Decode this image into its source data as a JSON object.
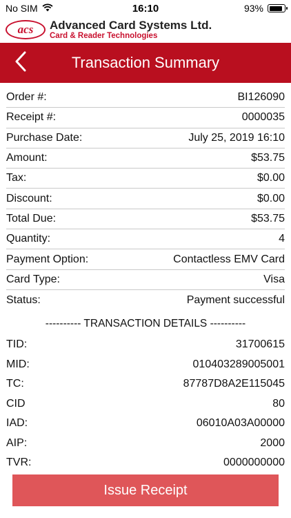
{
  "status_bar": {
    "carrier": "No SIM",
    "time": "16:10",
    "battery_percent": "93%",
    "battery_level": 0.93,
    "wifi_icon": "wifi-icon",
    "battery_icon": "battery-icon"
  },
  "brand": {
    "logo_text": "acs",
    "name": "Advanced Card Systems Ltd.",
    "tagline": "Card & Reader Technologies"
  },
  "nav": {
    "back_icon": "chevron-left-icon",
    "title": "Transaction Summary"
  },
  "summary": [
    {
      "label": "Order #:",
      "value": "BI126090"
    },
    {
      "label": "Receipt #:",
      "value": "0000035"
    },
    {
      "label": "Purchase Date:",
      "value": "July 25, 2019 16:10"
    },
    {
      "label": "Amount:",
      "value": "$53.75"
    },
    {
      "label": "Tax:",
      "value": "$0.00"
    },
    {
      "label": "Discount:",
      "value": "$0.00"
    },
    {
      "label": "Total Due:",
      "value": "$53.75"
    },
    {
      "label": "Quantity:",
      "value": "4"
    },
    {
      "label": "Payment Option:",
      "value": "Contactless EMV Card"
    },
    {
      "label": "Card Type:",
      "value": "Visa"
    },
    {
      "label": "Status:",
      "value": "Payment successful"
    }
  ],
  "details_heading": "---------- TRANSACTION DETAILS ----------",
  "details": [
    {
      "label": "TID:",
      "value": "31700615"
    },
    {
      "label": "MID:",
      "value": "010403289005001"
    },
    {
      "label": "TC:",
      "value": "87787D8A2E115045"
    },
    {
      "label": "CID",
      "value": "80"
    },
    {
      "label": "IAD:",
      "value": "06010A03A00000"
    },
    {
      "label": "AIP:",
      "value": "2000"
    },
    {
      "label": "TVR:",
      "value": "0000000000"
    }
  ],
  "actions": {
    "issue_receipt": "Issue Receipt"
  },
  "colors": {
    "brand_red": "#b90f1f",
    "button_red": "#df5659"
  }
}
